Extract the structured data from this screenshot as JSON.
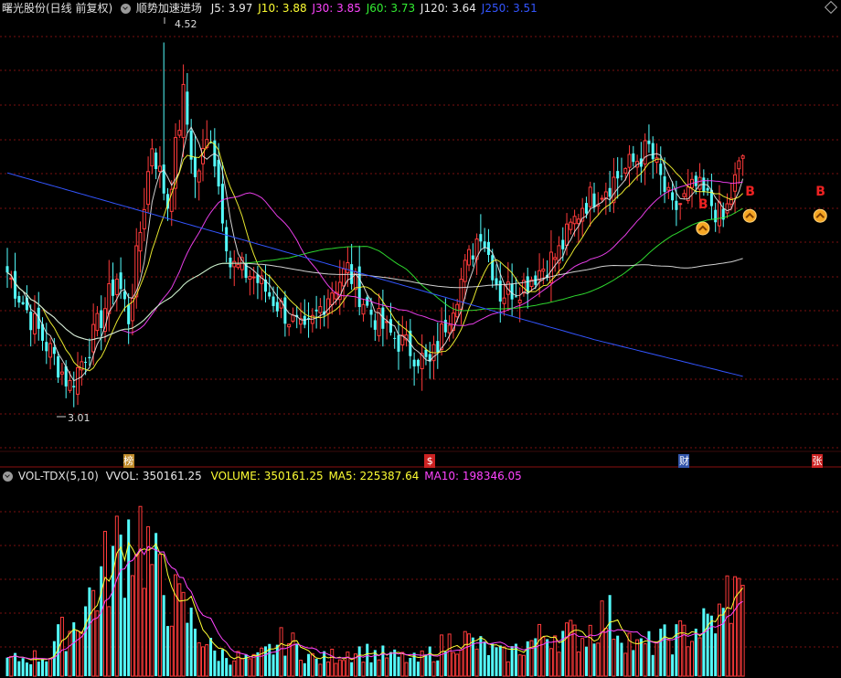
{
  "header": {
    "stock_name": "曙光股份(日线 前复权)",
    "indicator_name": "顺势加速进场",
    "items": [
      {
        "label": "J5: 3.97",
        "color": "#e8e8e8"
      },
      {
        "label": "J10: 3.88",
        "color": "#ffff33"
      },
      {
        "label": "J30: 3.85",
        "color": "#ff44ff"
      },
      {
        "label": "J60: 3.73",
        "color": "#33ee33"
      },
      {
        "label": "J120: 3.64",
        "color": "#e8e8e8"
      },
      {
        "label": "J250: 3.51",
        "color": "#3355ff"
      }
    ]
  },
  "vol_header": {
    "name": "VOL-TDX(5,10)",
    "items": [
      {
        "label": "VVOL: 350161.25",
        "color": "#e8e8e8"
      },
      {
        "label": "VOLUME: 350161.25",
        "color": "#ffff33"
      },
      {
        "label": "MA5: 225387.64",
        "color": "#ffff33"
      },
      {
        "label": "MA10: 198346.05",
        "color": "#ff44ff"
      }
    ]
  },
  "annotations": {
    "high": "4.52",
    "low": "3.01"
  },
  "event_markers": [
    {
      "label": "榜",
      "color": "#c08a2a",
      "bar": 31
    },
    {
      "label": "$",
      "color": "#cc2222",
      "bar": 108
    },
    {
      "label": "财",
      "color": "#3355aa",
      "bar": 173
    },
    {
      "label": "张",
      "color": "#cc2222",
      "bar": 207
    }
  ],
  "b_markers": [
    178,
    190,
    208
  ],
  "colors": {
    "up": "#ff3b3b",
    "down": "#54ffff",
    "grid": "#7a1010",
    "bg": "#000000"
  },
  "chart_data": {
    "type": "candlestick",
    "price_range": [
      2.85,
      4.62
    ],
    "high": 4.52,
    "low": 3.01,
    "segments": [
      [
        3.6,
        3.38,
        7
      ],
      [
        3.38,
        3.1,
        10
      ],
      [
        3.1,
        3.3,
        6
      ],
      [
        3.3,
        3.55,
        6
      ],
      [
        3.55,
        3.38,
        3
      ],
      [
        3.38,
        4.1,
        6
      ],
      [
        4.1,
        3.85,
        4
      ],
      [
        3.85,
        4.3,
        4
      ],
      [
        4.3,
        3.95,
        3
      ],
      [
        3.95,
        4.15,
        4
      ],
      [
        4.15,
        3.6,
        5
      ],
      [
        3.6,
        3.55,
        6
      ],
      [
        3.55,
        3.42,
        7
      ],
      [
        3.42,
        3.3,
        6
      ],
      [
        3.3,
        3.48,
        6
      ],
      [
        3.48,
        3.58,
        5
      ],
      [
        3.58,
        3.42,
        5
      ],
      [
        3.42,
        3.32,
        5
      ],
      [
        3.32,
        3.25,
        6
      ],
      [
        3.25,
        3.18,
        5
      ],
      [
        3.18,
        3.45,
        6
      ],
      [
        3.45,
        3.75,
        7
      ],
      [
        3.75,
        3.48,
        5
      ],
      [
        3.48,
        3.52,
        6
      ],
      [
        3.52,
        3.65,
        9
      ],
      [
        3.65,
        3.85,
        6
      ],
      [
        3.85,
        3.95,
        8
      ],
      [
        3.95,
        4.08,
        9
      ],
      [
        4.08,
        3.82,
        6
      ],
      [
        3.82,
        3.92,
        6
      ],
      [
        3.92,
        3.85,
        4
      ],
      [
        3.85,
        3.78,
        3
      ],
      [
        3.78,
        4.05,
        5
      ]
    ],
    "volume_range": [
      0,
      750000
    ],
    "volume_segments": [
      [
        60000,
        80000,
        12
      ],
      [
        120000,
        200000,
        6
      ],
      [
        200000,
        450000,
        10
      ],
      [
        450000,
        600000,
        6
      ],
      [
        600000,
        350000,
        6
      ],
      [
        350000,
        250000,
        6
      ],
      [
        250000,
        90000,
        8
      ],
      [
        90000,
        60000,
        10
      ],
      [
        60000,
        140000,
        8
      ],
      [
        140000,
        60000,
        8
      ],
      [
        60000,
        100000,
        10
      ],
      [
        100000,
        60000,
        16
      ],
      [
        60000,
        150000,
        10
      ],
      [
        150000,
        80000,
        12
      ],
      [
        80000,
        170000,
        12
      ],
      [
        170000,
        150000,
        8
      ],
      [
        150000,
        240000,
        6
      ],
      [
        240000,
        110000,
        8
      ],
      [
        110000,
        160000,
        12
      ],
      [
        160000,
        230000,
        10
      ],
      [
        230000,
        320000,
        1
      ],
      [
        320000,
        190000,
        21
      ]
    ],
    "volume_last": 350161.25
  }
}
